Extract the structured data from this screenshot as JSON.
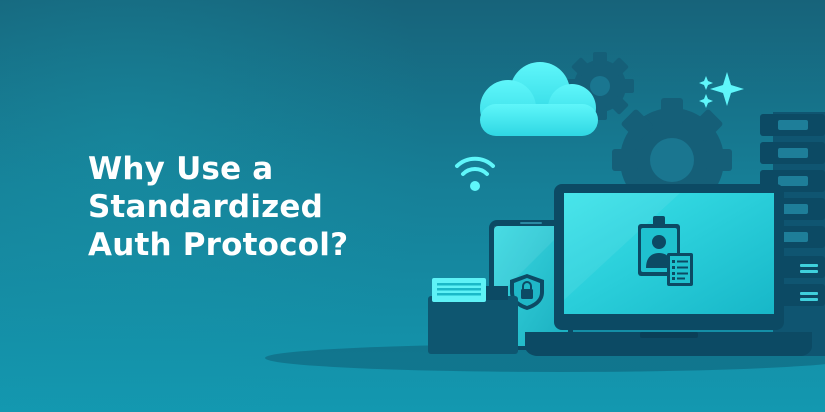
{
  "headline": {
    "lines": [
      "Why Use a",
      "Standardized",
      "Auth Protocol?"
    ]
  },
  "colors": {
    "background_top": "#17637a",
    "background_bottom": "#1398b0",
    "accent_cyan": "#4ff3f7",
    "device_dark": "#0c4a64",
    "screen": "#27d6df"
  },
  "illustration": {
    "icons": [
      "cloud-icon",
      "gear-icon",
      "sparkle-icon",
      "wifi-icon",
      "shield-lock-icon",
      "id-badge-icon",
      "checklist-icon"
    ],
    "devices": [
      "laptop",
      "smartphone",
      "server-rack",
      "document-stack"
    ]
  }
}
